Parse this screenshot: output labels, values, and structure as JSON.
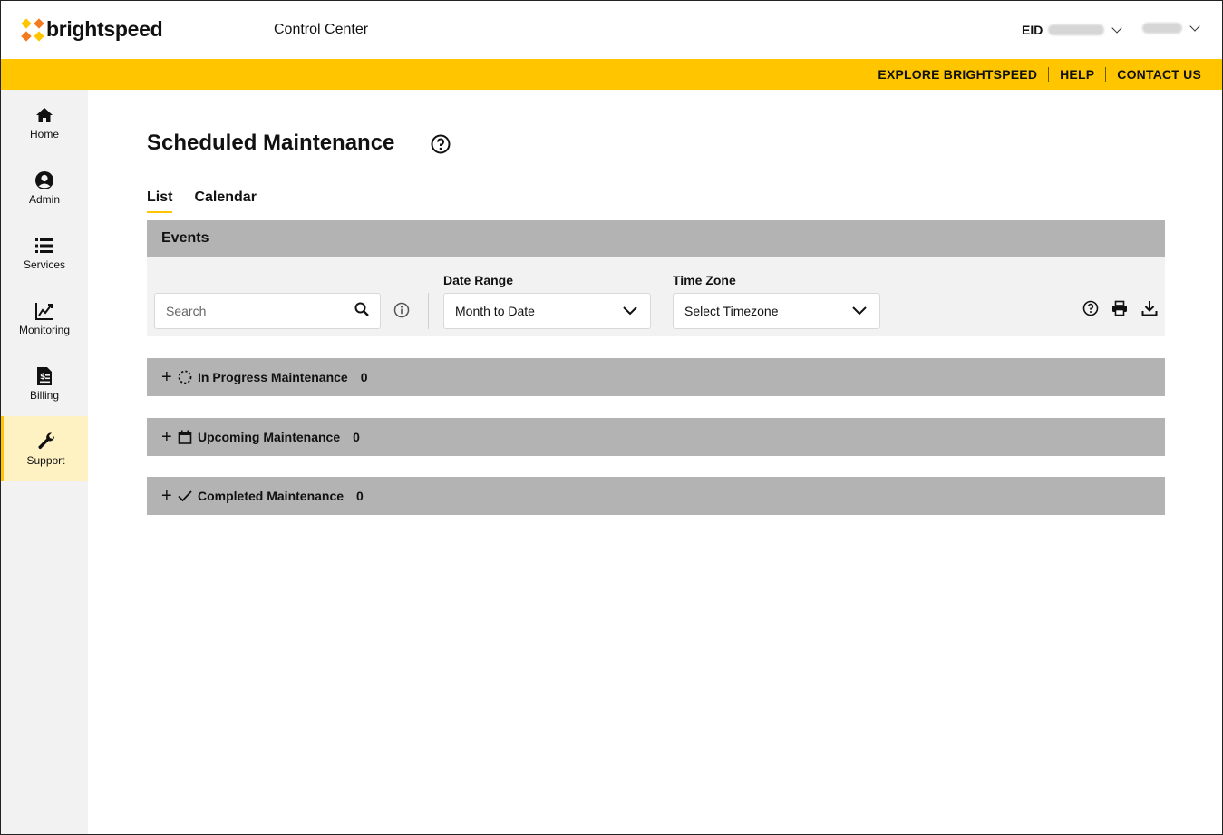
{
  "header": {
    "brand": "brightspeed",
    "app_title": "Control Center",
    "eid_label": "EID"
  },
  "top_links": [
    "EXPLORE BRIGHTSPEED",
    "HELP",
    "CONTACT US"
  ],
  "sidebar": {
    "items": [
      {
        "label": "Home",
        "icon": "home-icon"
      },
      {
        "label": "Admin",
        "icon": "user-circle-icon"
      },
      {
        "label": "Services",
        "icon": "list-icon"
      },
      {
        "label": "Monitoring",
        "icon": "chart-line-icon"
      },
      {
        "label": "Billing",
        "icon": "invoice-icon"
      },
      {
        "label": "Support",
        "icon": "wrench-icon",
        "active": true
      }
    ]
  },
  "page": {
    "title": "Scheduled Maintenance",
    "tabs": [
      {
        "label": "List",
        "active": true
      },
      {
        "label": "Calendar",
        "active": false
      }
    ]
  },
  "events": {
    "header": "Events",
    "search_placeholder": "Search",
    "date_range_label": "Date Range",
    "date_range_value": "Month to Date",
    "time_zone_label": "Time Zone",
    "time_zone_value": "Select Timezone"
  },
  "sections": [
    {
      "label": "In Progress Maintenance",
      "count": "0",
      "icon": "spinner-icon"
    },
    {
      "label": "Upcoming Maintenance",
      "count": "0",
      "icon": "calendar-icon"
    },
    {
      "label": "Completed Maintenance",
      "count": "0",
      "icon": "check-icon"
    }
  ],
  "colors": {
    "accent": "#ffc600",
    "section_bg": "#b3b3b3",
    "sidebar_bg": "#f2f2f2",
    "active_nav_bg": "#fff2c2"
  }
}
